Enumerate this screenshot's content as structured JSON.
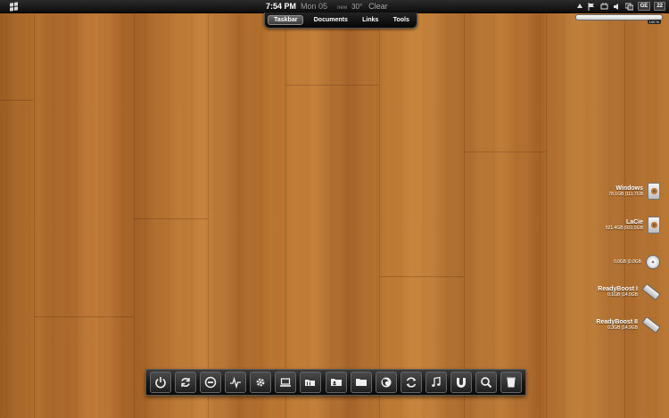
{
  "topbar": {
    "clock_time": "7:54 PM",
    "clock_date": "Mon 05",
    "weather_new": "new",
    "weather_temp": "30°",
    "weather_condition": "Clear",
    "tray": {
      "language_badge": "GE",
      "number_badge": "22",
      "icons": [
        "up-arrow-icon",
        "flag-icon",
        "power-plug-icon",
        "volume-icon",
        "network-icon"
      ]
    }
  },
  "menu": {
    "tabs": [
      {
        "label": "Taskbar",
        "active": true
      },
      {
        "label": "Documents",
        "active": false
      },
      {
        "label": "Links",
        "active": false
      },
      {
        "label": "Tools",
        "active": false
      }
    ]
  },
  "volume": {
    "level_percent": 100,
    "label": "100 %"
  },
  "drives": [
    {
      "name": "Windows",
      "usage": "78.1GB |111.7GB",
      "icon": "hard-drive-icon"
    },
    {
      "name": "LaCie",
      "usage": "521.4GB |931.5GB",
      "icon": "hard-drive-icon"
    },
    {
      "name": "",
      "usage": "0.0GB |0.0GB",
      "icon": "optical-disc-icon"
    },
    {
      "name": "ReadyBoost I",
      "usage": "0.1GB |14.9GB",
      "icon": "usb-drive-icon"
    },
    {
      "name": "ReadyBoost II",
      "usage": "0.3GB |14.9GB",
      "icon": "usb-drive-icon"
    }
  ],
  "dock": {
    "items": [
      "power-icon",
      "refresh-icon",
      "minus-circle-icon",
      "pulse-icon",
      "gear-icon",
      "laptop-icon",
      "folders-icon",
      "user-folder-icon",
      "folder-icon",
      "firefox-icon",
      "itunes-icon",
      "music-note-icon",
      "utorrent-icon",
      "search-icon",
      "trash-icon"
    ]
  }
}
